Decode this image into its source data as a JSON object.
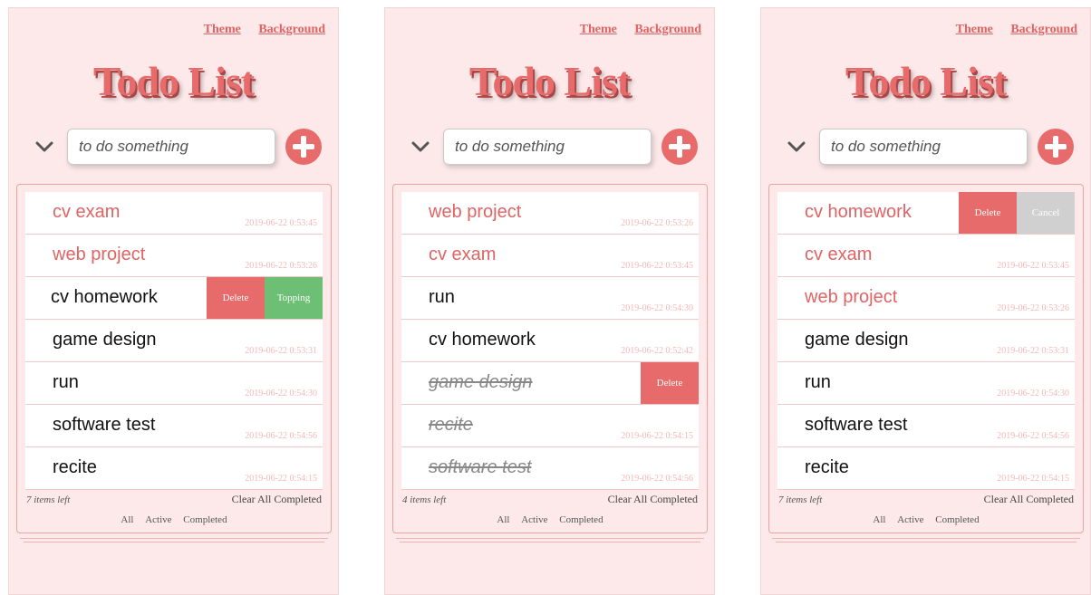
{
  "panels": [
    {
      "nav": {
        "theme": "Theme",
        "background": "Background"
      },
      "title": "Todo List",
      "input_placeholder": "to do something",
      "items": [
        {
          "text": "cv exam",
          "time": "2019-06-22 0:53:45"
        },
        {
          "text": "web project",
          "time": "2019-06-22 0:53:26"
        },
        {
          "text": "cv homework",
          "time": "",
          "actions": [
            "Delete",
            "Topping"
          ]
        },
        {
          "text": "game design",
          "time": "2019-06-22 0:53:31"
        },
        {
          "text": "run",
          "time": "2019-06-22 0:54:30"
        },
        {
          "text": "software test",
          "time": "2019-06-22 0:54:56"
        },
        {
          "text": "recite",
          "time": "2019-06-22 0:54:15"
        }
      ],
      "items_left": "7 items left",
      "clear": "Clear All Completed",
      "filters": [
        "All",
        "Active",
        "Completed"
      ]
    },
    {
      "nav": {
        "theme": "Theme",
        "background": "Background"
      },
      "title": "Todo List",
      "input_placeholder": "to do something",
      "items": [
        {
          "text": "web project",
          "time": "2019-06-22 0:53:26"
        },
        {
          "text": "cv exam",
          "time": "2019-06-22 0:53:45"
        },
        {
          "text": "run",
          "time": "2019-06-22 0:54:30"
        },
        {
          "text": "cv homework",
          "time": "2019-06-22 0:52:42"
        },
        {
          "text": "game design",
          "time": "",
          "actions": [
            "Delete"
          ]
        },
        {
          "text": "recite",
          "time": "2019-06-22 0:54:15"
        },
        {
          "text": "software test",
          "time": "2019-06-22 0:54:56"
        }
      ],
      "items_left": "4 items left",
      "clear": "Clear All Completed",
      "filters": [
        "All",
        "Active",
        "Completed"
      ]
    },
    {
      "nav": {
        "theme": "Theme",
        "background": "Background"
      },
      "title": "Todo List",
      "input_placeholder": "to do something",
      "items": [
        {
          "text": "cv homework",
          "time": "",
          "actions": [
            "Delete",
            "Cancel"
          ]
        },
        {
          "text": "cv exam",
          "time": "2019-06-22 0:53:45"
        },
        {
          "text": "web project",
          "time": "2019-06-22 0:53:26"
        },
        {
          "text": "game design",
          "time": "2019-06-22 0:53:31"
        },
        {
          "text": "run",
          "time": "2019-06-22 0:54:30"
        },
        {
          "text": "software test",
          "time": "2019-06-22 0:54:56"
        },
        {
          "text": "recite",
          "time": "2019-06-22 0:54:15"
        }
      ],
      "items_left": "7 items left",
      "clear": "Clear All Completed",
      "filters": [
        "All",
        "Active",
        "Completed"
      ]
    }
  ],
  "colors": {
    "accent": "#e86b6b",
    "topping": "#6cbf74",
    "cancel": "#d0d0d0",
    "panel_bg": "#fde9e9"
  }
}
